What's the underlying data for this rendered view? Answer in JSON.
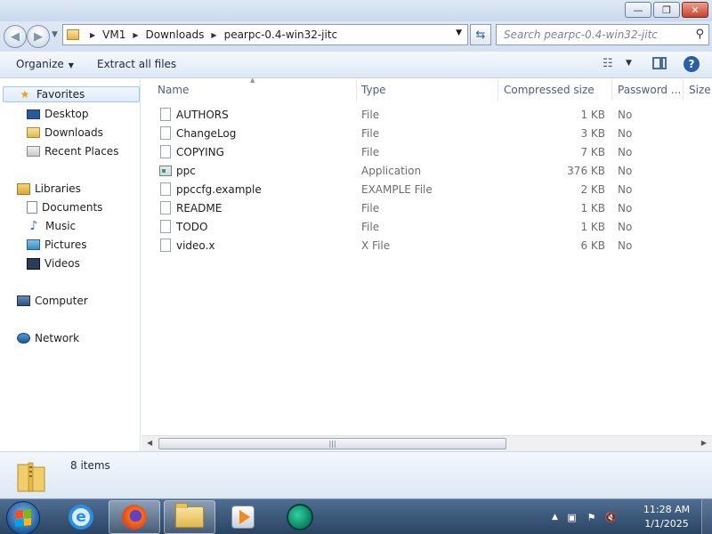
{
  "window": {
    "minimize_glyph": "—",
    "maximize_glyph": "❐",
    "close_glyph": "✕"
  },
  "address": {
    "crumbs": [
      "VM1",
      "Downloads",
      "pearpc-0.4-win32-jitc"
    ],
    "search_placeholder": "Search pearpc-0.4-win32-jitc"
  },
  "commands": {
    "organize": "Organize",
    "extract": "Extract all files"
  },
  "nav": {
    "favorites": "Favorites",
    "desktop": "Desktop",
    "downloads": "Downloads",
    "recent": "Recent Places",
    "libraries": "Libraries",
    "documents": "Documents",
    "music": "Music",
    "pictures": "Pictures",
    "videos": "Videos",
    "computer": "Computer",
    "network": "Network"
  },
  "columns": {
    "name": "Name",
    "type": "Type",
    "compressed": "Compressed size",
    "password": "Password ...",
    "size": "Size"
  },
  "files": [
    {
      "name": "AUTHORS",
      "type": "File",
      "size": "1 KB",
      "pwd": "No"
    },
    {
      "name": "ChangeLog",
      "type": "File",
      "size": "3 KB",
      "pwd": "No"
    },
    {
      "name": "COPYING",
      "type": "File",
      "size": "7 KB",
      "pwd": "No"
    },
    {
      "name": "ppc",
      "type": "Application",
      "size": "376 KB",
      "pwd": "No"
    },
    {
      "name": "ppccfg.example",
      "type": "EXAMPLE File",
      "size": "2 KB",
      "pwd": "No"
    },
    {
      "name": "README",
      "type": "File",
      "size": "1 KB",
      "pwd": "No"
    },
    {
      "name": "TODO",
      "type": "File",
      "size": "1 KB",
      "pwd": "No"
    },
    {
      "name": "video.x",
      "type": "X File",
      "size": "6 KB",
      "pwd": "No"
    }
  ],
  "details": {
    "count": "8 items"
  },
  "taskbar": {
    "time": "11:28 AM",
    "date": "1/1/2025"
  }
}
